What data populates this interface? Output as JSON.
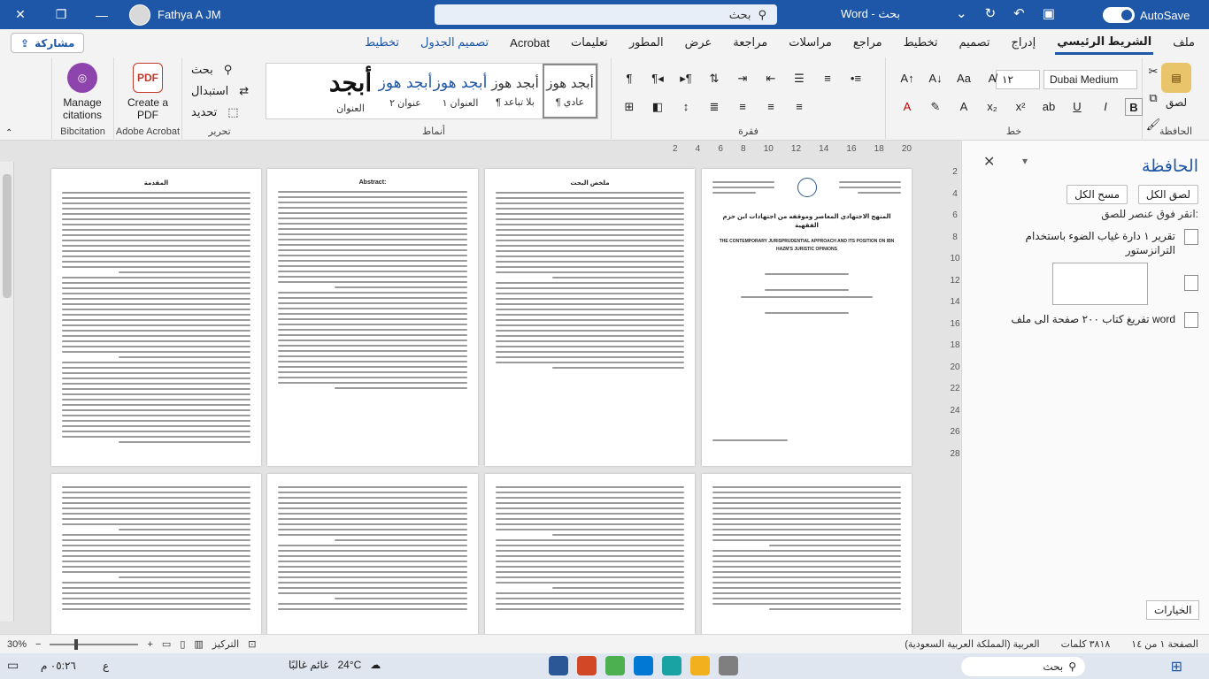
{
  "titlebar": {
    "user": "Fathya A JM",
    "search": "بحث",
    "docname": "Word - بحث",
    "autosave": "AutoSave"
  },
  "tabs": [
    {
      "label": "ملف",
      "state": "normal"
    },
    {
      "label": "الشريط الرئيسي",
      "state": "active"
    },
    {
      "label": "إدراج",
      "state": "normal"
    },
    {
      "label": "تصميم",
      "state": "normal"
    },
    {
      "label": "تخطيط",
      "state": "normal"
    },
    {
      "label": "مراجع",
      "state": "normal"
    },
    {
      "label": "مراسلات",
      "state": "normal"
    },
    {
      "label": "مراجعة",
      "state": "normal"
    },
    {
      "label": "عرض",
      "state": "normal"
    },
    {
      "label": "المطور",
      "state": "normal"
    },
    {
      "label": "تعليمات",
      "state": "normal"
    },
    {
      "label": "Acrobat",
      "state": "normal"
    },
    {
      "label": "تصميم الجدول",
      "state": "blue"
    },
    {
      "label": "تخطيط",
      "state": "blue"
    }
  ],
  "share_label": "مشاركة",
  "ribbon": {
    "clipboard_label": "الحافظة",
    "paste_label": "لصق",
    "font_label": "خط",
    "font_name": "Dubai Medium",
    "font_size": "١٢",
    "paragraph_label": "فقرة",
    "styles_label": "أنماط",
    "editing_label": "تحرير",
    "find_label": "بحث",
    "replace_label": "استبدال",
    "select_label": "تحديد",
    "acrobat_label": "Adobe Acrobat",
    "create_pdf_label": "Create a PDF",
    "bibcitation_label": "Bibcitation",
    "manage_citations_label": "Manage citations",
    "styles": [
      {
        "sample": "أبجد هوز",
        "name": "¶ عادي",
        "kind": "sel"
      },
      {
        "sample": "أبجد هوز",
        "name": "¶ بلا تباعد",
        "kind": "normal"
      },
      {
        "sample": "أبجد هوز",
        "name": "العنوان ١",
        "kind": "head"
      },
      {
        "sample": "أبجد هوز",
        "name": "عنوان ٢",
        "kind": "head"
      },
      {
        "sample": "أبجد",
        "name": "العنوان",
        "kind": "title"
      }
    ]
  },
  "ruler": [
    "2",
    "4",
    "6",
    "8",
    "10",
    "12",
    "14",
    "16",
    "18",
    "20"
  ],
  "vruler": [
    "2",
    "4",
    "6",
    "8",
    "10",
    "12",
    "14",
    "16",
    "18",
    "20",
    "22",
    "24",
    "26",
    "28"
  ],
  "pages": {
    "p1_title": "المنهج الاجتهادي المعاصر وموقفه من اجتهادات ابن حزم الفقهية",
    "p1_subtitle": "THE CONTEMPORARY JURISPRUDENTIAL APPROACH AND ITS POSITION ON IBN HAZM'S JURISTIC OPINIONS",
    "p2_heading": "ملخص البحث",
    "p3_heading": "Abstract:",
    "p4_heading": "المقدمة"
  },
  "pane": {
    "title": "الحافظة",
    "paste_all": "لصق الكل",
    "clear_all": "مسح الكل",
    "hint": "انقر فوق عنصر للصق:",
    "items": [
      "تقرير ١ دارة غياب الضوء باستخدام الترانزستور",
      "تفريغ كتاب ٢٠٠ صفحة الى ملف word"
    ],
    "options": "الخيارات"
  },
  "status": {
    "page": "الصفحة ١ من ١٤",
    "words": "٣٨١٨ كلمات",
    "language": "العربية (المملكة العربية السعودية)",
    "focus": "التركيز",
    "zoom": "30%"
  },
  "taskbar": {
    "search": "بحث",
    "weather_temp": "24°C",
    "weather_desc": "غائم غالبًا",
    "time": "٠٥:٢٦ م",
    "lang": "ع"
  }
}
